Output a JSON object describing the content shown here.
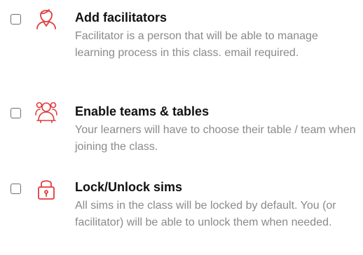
{
  "options": [
    {
      "title": "Add facilitators",
      "description": "Facilitator is a person that will be able to manage learning process in this class. email required.",
      "icon": "facilitator-person-icon",
      "checked": false
    },
    {
      "title": "Enable teams & tables",
      "description": "Your learners will have to choose their table / team when joining the class.",
      "icon": "teams-group-icon",
      "checked": false
    },
    {
      "title": "Lock/Unlock sims",
      "description": "All sims in the class will be locked by default. You (or facilitator) will be able to unlock them when needed.",
      "icon": "padlock-icon",
      "checked": false
    }
  ],
  "colors": {
    "icon_accent": "#e23b3b",
    "title": "#111111",
    "description": "#8a8a8a",
    "checkbox_border": "#6e6e6e"
  }
}
